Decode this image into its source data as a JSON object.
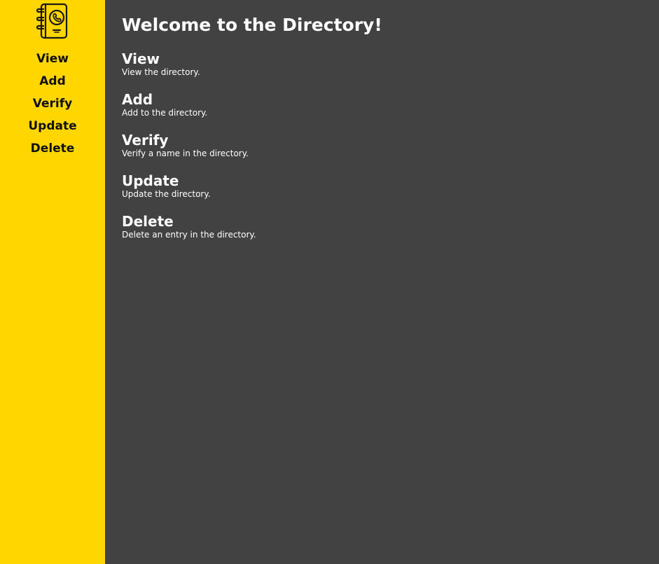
{
  "sidebar": {
    "logo_icon": "phone-book-icon",
    "items": [
      {
        "label": "View"
      },
      {
        "label": "Add"
      },
      {
        "label": "Verify"
      },
      {
        "label": "Update"
      },
      {
        "label": "Delete"
      }
    ]
  },
  "main": {
    "title": "Welcome to the Directory!",
    "sections": [
      {
        "title": "View",
        "description": "View the directory."
      },
      {
        "title": "Add",
        "description": "Add to the directory."
      },
      {
        "title": "Verify",
        "description": "Verify a name in the directory."
      },
      {
        "title": "Update",
        "description": "Update the directory."
      },
      {
        "title": "Delete",
        "description": "Delete an entry in the directory."
      }
    ]
  },
  "colors": {
    "sidebar_bg": "#ffd600",
    "main_bg": "#424242",
    "text_light": "#ffffff",
    "text_dark": "#111111"
  }
}
